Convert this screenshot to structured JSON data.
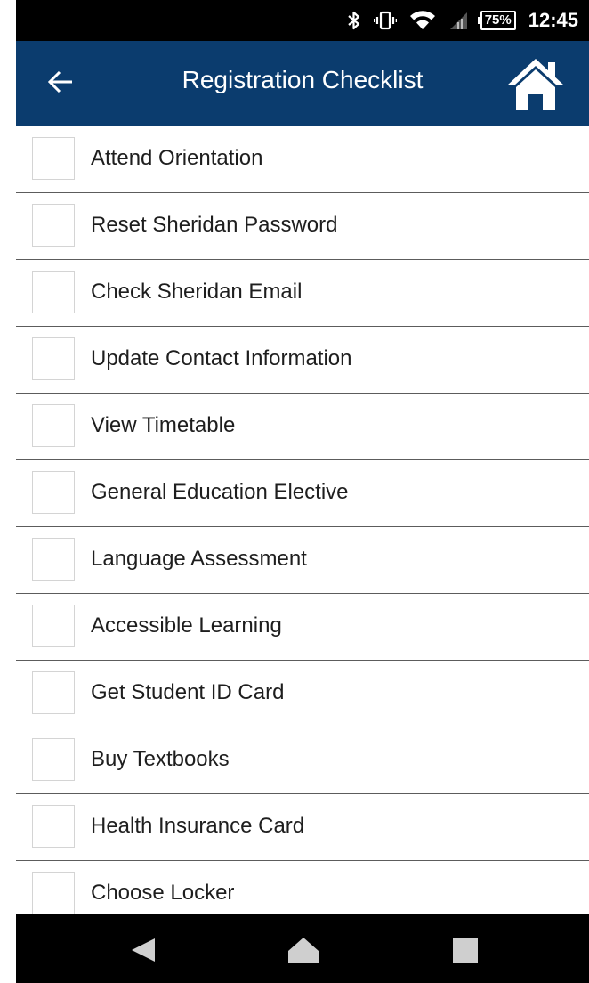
{
  "status_bar": {
    "battery": "75%",
    "time": "12:45",
    "icons": [
      "bluetooth-icon",
      "vibrate-icon",
      "wifi-icon",
      "cell-signal-icon"
    ]
  },
  "header": {
    "title": "Registration Checklist",
    "back_icon": "back-arrow-icon",
    "home_icon": "home-icon",
    "background_color": "#0b3c6e"
  },
  "checklist": {
    "items": [
      {
        "label": "Attend Orientation",
        "checked": false
      },
      {
        "label": "Reset Sheridan Password",
        "checked": false
      },
      {
        "label": "Check Sheridan Email",
        "checked": false
      },
      {
        "label": "Update Contact Information",
        "checked": false
      },
      {
        "label": "View Timetable",
        "checked": false
      },
      {
        "label": "General Education Elective",
        "checked": false
      },
      {
        "label": "Language Assessment",
        "checked": false
      },
      {
        "label": "Accessible Learning",
        "checked": false
      },
      {
        "label": "Get Student ID Card",
        "checked": false
      },
      {
        "label": "Buy Textbooks",
        "checked": false
      },
      {
        "label": "Health Insurance Card",
        "checked": false
      },
      {
        "label": "Choose Locker",
        "checked": false
      }
    ]
  },
  "nav_bar": {
    "buttons": [
      "back-triangle-icon",
      "home-circle-icon",
      "recents-square-icon"
    ]
  }
}
